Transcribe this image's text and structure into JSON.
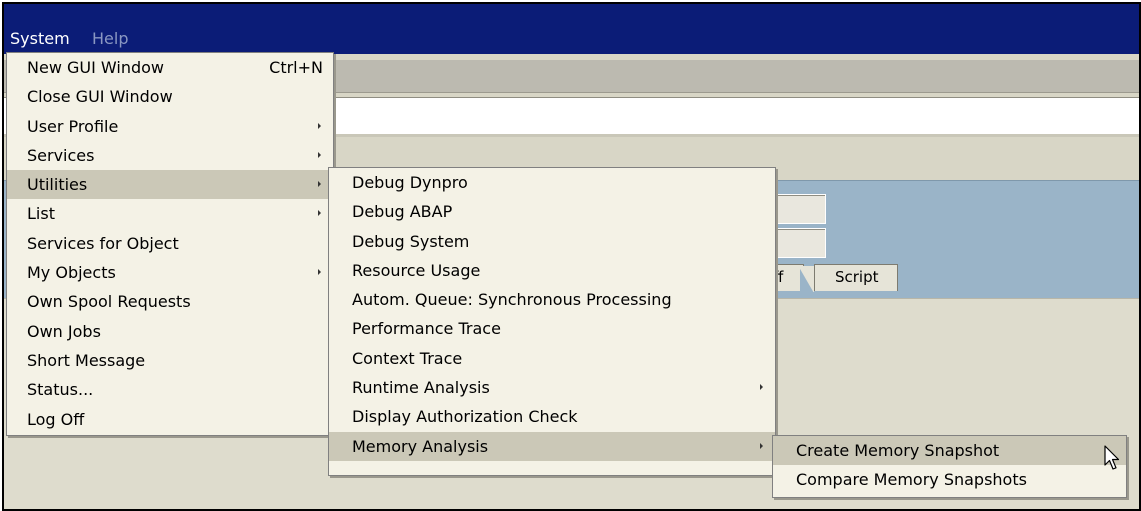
{
  "menubar": {
    "items": [
      {
        "label": "System",
        "active": true
      },
      {
        "label": "Help",
        "active": false
      }
    ]
  },
  "background": {
    "tabs": [
      {
        "label": "ff"
      },
      {
        "label": "Script"
      }
    ]
  },
  "system_menu": {
    "items": [
      {
        "label": "New GUI Window",
        "accelerator": "Ctrl+N",
        "submenu": false,
        "selected": false
      },
      {
        "label": "Close GUI Window",
        "submenu": false,
        "selected": false
      },
      {
        "label": "User Profile",
        "submenu": true,
        "selected": false
      },
      {
        "label": "Services",
        "submenu": true,
        "selected": false
      },
      {
        "label": "Utilities",
        "submenu": true,
        "selected": true
      },
      {
        "label": "List",
        "submenu": true,
        "selected": false
      },
      {
        "label": "Services for Object",
        "submenu": false,
        "selected": false
      },
      {
        "label": "My Objects",
        "submenu": true,
        "selected": false
      },
      {
        "label": "Own Spool Requests",
        "submenu": false,
        "selected": false
      },
      {
        "label": "Own Jobs",
        "submenu": false,
        "selected": false
      },
      {
        "label": "Short Message",
        "submenu": false,
        "selected": false
      },
      {
        "label": "Status...",
        "submenu": false,
        "selected": false
      },
      {
        "label": "Log Off",
        "submenu": false,
        "selected": false
      }
    ]
  },
  "utilities_menu": {
    "items": [
      {
        "label": "Debug Dynpro",
        "submenu": false,
        "selected": false
      },
      {
        "label": "Debug ABAP",
        "submenu": false,
        "selected": false
      },
      {
        "label": "Debug System",
        "submenu": false,
        "selected": false
      },
      {
        "label": "Resource Usage",
        "submenu": false,
        "selected": false
      },
      {
        "label": "Autom. Queue: Synchronous Processing",
        "submenu": false,
        "selected": false
      },
      {
        "label": "Performance Trace",
        "submenu": false,
        "selected": false
      },
      {
        "label": "Context Trace",
        "submenu": false,
        "selected": false
      },
      {
        "label": "Runtime Analysis",
        "submenu": true,
        "selected": false
      },
      {
        "label": "Display Authorization Check",
        "submenu": false,
        "selected": false
      },
      {
        "label": "Memory Analysis",
        "submenu": true,
        "selected": true
      }
    ]
  },
  "memory_menu": {
    "items": [
      {
        "label": "Create Memory Snapshot",
        "selected": true
      },
      {
        "label": "Compare Memory Snapshots",
        "selected": false
      }
    ]
  },
  "icons": {
    "cursor": "mouse-pointer-icon",
    "submenu_arrow": "submenu-arrow-icon"
  },
  "colors": {
    "menubar": "#0b1c77",
    "menu_background": "#f4f2e6",
    "menu_selected": "#cbc8b7",
    "screen_panel": "#9ab4c8"
  }
}
